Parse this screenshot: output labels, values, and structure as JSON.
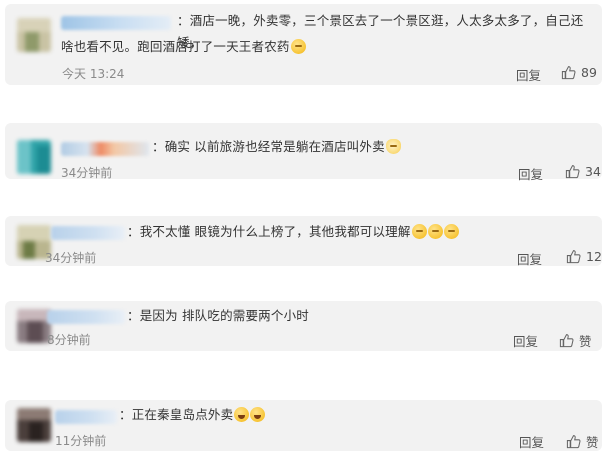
{
  "comments": [
    {
      "text": "：酒店一晚，外卖零，三个景区去了一个景区逛，人太多太多了，自己还矮，",
      "text2": "啥也看不见。跑回酒店打了一天王者农药",
      "emojis": [
        "smile-emoji"
      ],
      "time": "今天 13:24",
      "reply": "回复",
      "likes": "89"
    },
    {
      "text": "：确实 以前旅游也经常是躺在酒店叫外卖",
      "emojis": [
        "cat-emoji"
      ],
      "time": "34分钟前",
      "reply": "回复",
      "likes": "34"
    },
    {
      "text": "：我不太懂 眼镜为什么上榜了，其他我都可以理解",
      "emojis": [
        "speechless-emoji",
        "speechless-emoji",
        "speechless-emoji"
      ],
      "time": "34分钟前",
      "reply": "回复",
      "likes": "12"
    },
    {
      "text": "：是因为 排队吃的需要两个小时",
      "emojis": [],
      "time": "8分钟前",
      "reply": "回复",
      "likes": "赞"
    },
    {
      "text": "：正在秦皇岛点外卖",
      "emojis": [
        "laugh-cry-emoji",
        "laugh-cry-emoji"
      ],
      "time": "11分钟前",
      "reply": "回复",
      "likes": "赞"
    }
  ]
}
